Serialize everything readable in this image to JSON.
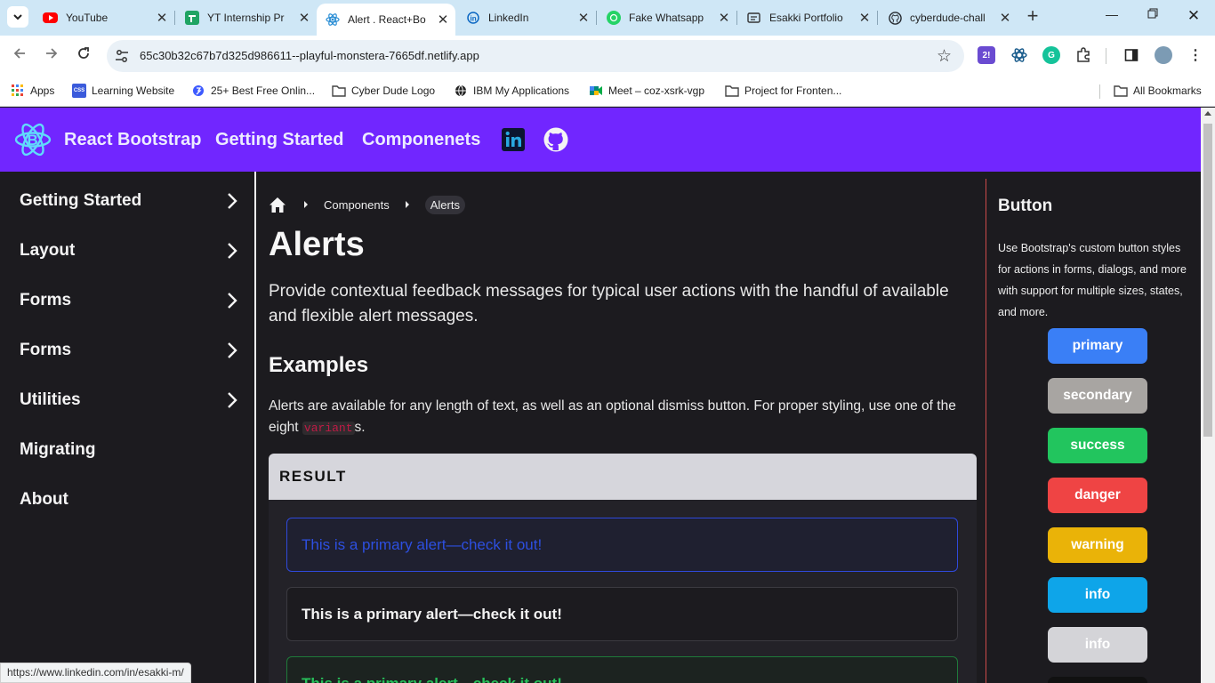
{
  "browser": {
    "tabs": [
      {
        "title": "YouTube",
        "icon": "youtube-icon",
        "color": "#ff0000",
        "active": false
      },
      {
        "title": "YT Internship Pr",
        "icon": "sheets-icon",
        "color": "#1fa463",
        "active": false
      },
      {
        "title": "Alert . React+Bo",
        "icon": "react-icon",
        "color": "#2d8fd5",
        "active": true
      },
      {
        "title": "LinkedIn",
        "icon": "linkedin-icon",
        "color": "#0a66c2",
        "active": false
      },
      {
        "title": "Fake Whatsapp",
        "icon": "whatsapp-icon",
        "color": "#25d366",
        "active": false
      },
      {
        "title": "Esakki Portfolio",
        "icon": "portfolio-icon",
        "color": "#333333",
        "active": false
      },
      {
        "title": "cyberdude-chall",
        "icon": "github-icon",
        "color": "#24292f",
        "active": false
      }
    ],
    "url": "65c30b32c67b7d325d986611--playful-monstera-7665df.netlify.app",
    "bookmarks": [
      {
        "label": "Apps",
        "icon": "apps-grid-icon"
      },
      {
        "label": "Learning Website",
        "icon": "css-grid-icon"
      },
      {
        "label": "25+ Best Free Onlin...",
        "icon": "site-icon"
      },
      {
        "label": "Cyber Dude Logo",
        "icon": "folder-icon"
      },
      {
        "label": "IBM My Applications",
        "icon": "globe-icon"
      },
      {
        "label": "Meet – coz-xsrk-vgp",
        "icon": "meet-icon"
      },
      {
        "label": "Project for Fronten...",
        "icon": "folder-icon"
      }
    ],
    "all_bookmarks": "All Bookmarks",
    "status_url": "https://www.linkedin.com/in/esakki-m/"
  },
  "header": {
    "brand": "React Bootstrap",
    "links": [
      "Getting Started",
      "Componenets"
    ]
  },
  "sidebar": {
    "items": [
      {
        "label": "Getting Started",
        "has_chevron": true
      },
      {
        "label": "Layout",
        "has_chevron": true
      },
      {
        "label": "Forms",
        "has_chevron": true
      },
      {
        "label": "Forms",
        "has_chevron": true
      },
      {
        "label": "Utilities",
        "has_chevron": true
      },
      {
        "label": "Migrating",
        "has_chevron": false
      },
      {
        "label": "About",
        "has_chevron": false
      }
    ]
  },
  "main": {
    "breadcrumb": [
      "Components",
      "Alerts"
    ],
    "title": "Alerts",
    "lead": "Provide contextual feedback messages for typical user actions with the handful of available and flexible alert messages.",
    "examples_heading": "Examples",
    "examples_text_before": "Alerts are available for any length of text, as well as an optional dismiss button. For proper styling, use one of the eight ",
    "examples_code": "variant",
    "examples_text_after": "s.",
    "result_label": "RESULT",
    "alerts": [
      {
        "text": "This is a primary alert—check it out!",
        "variant": "primary"
      },
      {
        "text": "This is a primary alert—check it out!",
        "variant": "secondary"
      },
      {
        "text": "This is a primary alert—check it out!",
        "variant": "success"
      }
    ]
  },
  "aside": {
    "title": "Button",
    "text": "Use Bootstrap's custom button styles for actions in forms, dialogs, and more with support for multiple sizes, states, and more.",
    "buttons": [
      {
        "label": "primary",
        "color": "#3a7ff6"
      },
      {
        "label": "secondary",
        "color": "#a8a5a2"
      },
      {
        "label": "success",
        "color": "#22c55e"
      },
      {
        "label": "danger",
        "color": "#ef4444"
      },
      {
        "label": "warning",
        "color": "#eab308"
      },
      {
        "label": "info",
        "color": "#0ea5e9"
      },
      {
        "label": "info",
        "color": "#d4d4d8"
      }
    ]
  },
  "colors": {
    "header_bg": "#7126ff",
    "page_bg": "#1c1b1f",
    "aside_divider": "#cc4a4a"
  }
}
